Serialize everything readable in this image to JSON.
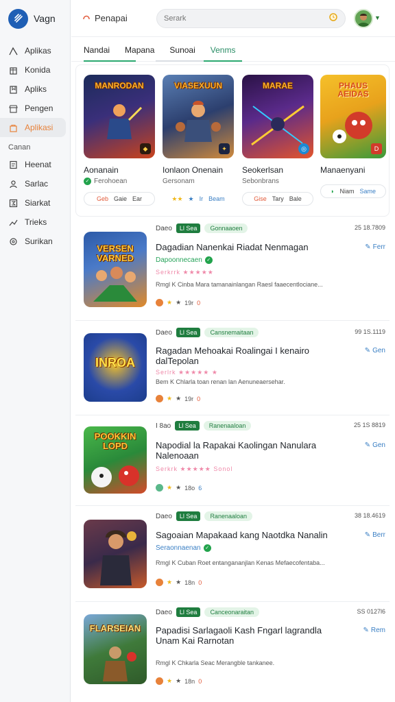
{
  "app": {
    "name": "Vagn"
  },
  "header": {
    "title": "Penapai",
    "search_placeholder": "Serark"
  },
  "sidebar": {
    "items_top": [
      {
        "label": "Aplikas",
        "icon": "chart-icon"
      },
      {
        "label": "Konida",
        "icon": "building-icon"
      },
      {
        "label": "Apliks",
        "icon": "bookmark-icon"
      },
      {
        "label": "Pengen",
        "icon": "store-icon"
      },
      {
        "label": "Aplikasi",
        "icon": "bag-icon",
        "active": true
      }
    ],
    "section_label": "Canan",
    "items_bottom": [
      {
        "label": "Heenat",
        "icon": "doc-icon"
      },
      {
        "label": "Sarlac",
        "icon": "user-icon"
      },
      {
        "label": "Siarkat",
        "icon": "sigma-icon"
      },
      {
        "label": "Trieks",
        "icon": "trend-icon"
      },
      {
        "label": "Surikan",
        "icon": "settings-icon"
      }
    ]
  },
  "tabs": [
    "Nandai",
    "Mapana",
    "Sunoai",
    "Venms"
  ],
  "featured": [
    {
      "art_text": "MANRODAN",
      "title": "Aonanain",
      "subtitle": "Ferohoean",
      "pill": [
        "Geb",
        "Gaie",
        "Ear"
      ],
      "colors": [
        "#1c2b5a",
        "#c9431c"
      ]
    },
    {
      "art_text": "VIASEXUUN",
      "title": "Ionlaon Onenain",
      "subtitle": "Gersonam",
      "pill": [
        "★★",
        "★",
        "Ir",
        "Beam"
      ],
      "colors": [
        "#2c3f6e",
        "#d08a3c"
      ]
    },
    {
      "art_text": "MARAE",
      "title": "Seokerlsan",
      "subtitle": "Sebonbrans",
      "pill": [
        "Gise",
        "Tary",
        "Bale"
      ],
      "colors": [
        "#2a1245",
        "#e3552c"
      ]
    },
    {
      "art_text": "PHAUS AEIDAS",
      "title": "Manaenyani",
      "subtitle": "",
      "pill": [
        "Niam",
        "Same"
      ],
      "colors": [
        "#e8a21c",
        "#d23b2a"
      ]
    }
  ],
  "list": [
    {
      "art_text": "VERSEN VARNED",
      "meta_left": "Daeo",
      "chip_dark": "Ll Sea",
      "chip_light": "Gonnaaoen",
      "time": "25 18.7809",
      "title": "Dagadian Nanenkai Riadat Nenmagan",
      "action": "Ferr",
      "subtitle": "Dapoonnecaen",
      "stars_text": "Serkrrk ★★★★★",
      "desc": "Rmgl K Cinba Mara tamanainlangan Raesl faaecentlociane...",
      "foot": [
        "★",
        "19r",
        "0"
      ],
      "colors": [
        "#2c5aa8",
        "#e08a2a"
      ]
    },
    {
      "art_text": "INROA",
      "meta_left": "Daeo",
      "chip_dark": "Ll Sea",
      "chip_light": "Cansnemaitaan",
      "time": "99 1S.1119",
      "title": "Ragadan Mehoakai Roalingai I kenairo dalTepolan",
      "action": "Gen",
      "subtitle": "",
      "stars_text": "Serlrk ★★★★★ ★",
      "desc": "Bem K Chlarla toan renan lan Aenuneaersehar.",
      "foot": [
        "★",
        "19r",
        "0"
      ],
      "colors": [
        "#1c3d8c",
        "#f2c02a"
      ]
    },
    {
      "art_text": "POOKKIN LOPD",
      "meta_left": "I 8ao",
      "chip_dark": "Ll Sea",
      "chip_light": "Ranenaaloan",
      "time": "25 1S 8819",
      "title": "Napodial la Rapakai Kaolingan Nanulara Nalenoaan",
      "action": "Gen",
      "subtitle": "",
      "stars_text": "Serkrk ★★★★★ Sonol",
      "desc": "",
      "foot": [
        "★",
        "18o",
        "6"
      ],
      "colors": [
        "#2a8a3a",
        "#d44a2a"
      ]
    },
    {
      "art_text": "",
      "meta_left": "Daeo",
      "chip_dark": "Ll Sea",
      "chip_light": "Ranenaaloan",
      "time": "38 18.4619",
      "title": "Sagoaian Mapakaad kang Naotdka Nanalin",
      "action": "Berr",
      "subtitle": "Seraonnaenan",
      "stars_text": "",
      "desc": "Rmgl K Cuban Roet entangananjlan Kenas Mefaecofentaba...",
      "foot": [
        "★",
        "18n",
        "0"
      ],
      "colors": [
        "#3a2a4a",
        "#c85a2a"
      ]
    },
    {
      "art_text": "FLARSEIAN",
      "meta_left": "Daeo",
      "chip_dark": "Ll Sea",
      "chip_light": "Canceonaraitan",
      "time": "SS 0127l6",
      "title": "Papadisi Sarlagaoli Kash Fngarl lagrandla Unam Kai Rarnotan",
      "action": "Rem",
      "subtitle": "",
      "stars_text": "",
      "desc": "Rmgl K Chkarla Seac Merangble tankanee.",
      "foot": [
        "★",
        "18n",
        "0"
      ],
      "colors": [
        "#2f5a2a",
        "#c8a25a"
      ]
    }
  ]
}
